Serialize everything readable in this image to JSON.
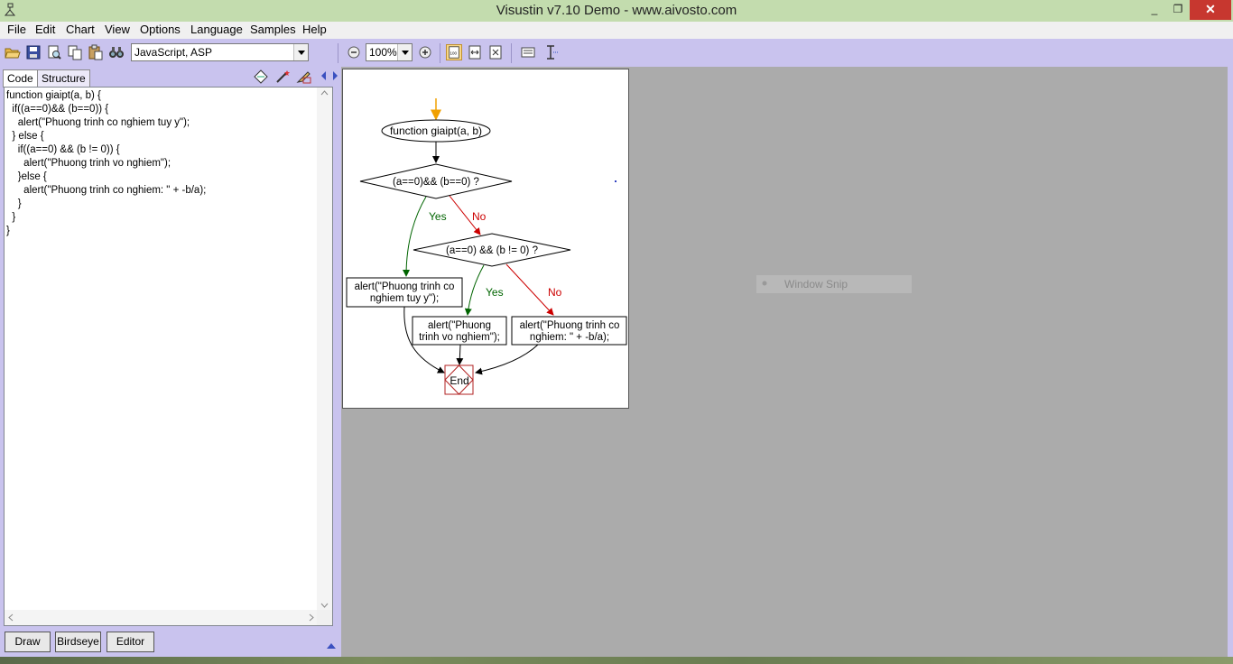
{
  "window": {
    "title": "Visustin v7.10 Demo - www.aivosto.com",
    "minimize": "_",
    "maximize": "❐",
    "close": "✕"
  },
  "menu": [
    "File",
    "Edit",
    "Chart",
    "View",
    "Options",
    "Language",
    "Samples",
    "Help"
  ],
  "toolbar": {
    "language": "JavaScript, ASP",
    "zoom": "100%",
    "icons": [
      "open-icon",
      "save-icon",
      "print-preview-icon",
      "copy-icon",
      "paste-icon",
      "find-icon",
      "zoom-out-icon",
      "zoom-in-icon",
      "actual-size-icon",
      "fit-width-icon",
      "fit-page-icon",
      "options-icon",
      "text-cursor-icon"
    ]
  },
  "tabs": {
    "code": "Code",
    "structure": "Structure"
  },
  "code": "function giaipt(a, b) {\n  if((a==0)&& (b==0)) {\n    alert(\"Phuong trinh co nghiem tuy y\");\n  } else {\n    if((a==0) && (b != 0)) {\n      alert(\"Phuong trinh vo nghiem\");\n    }else {\n      alert(\"Phuong trinh co nghiem: \" + -b/a);\n    }\n  }\n}",
  "buttons": {
    "draw": "Draw",
    "birdseye": "Birdseye",
    "editor": "Editor"
  },
  "flowchart": {
    "start": "function giaipt(a, b)",
    "cond1": "(a==0)&& (b==0) ?",
    "cond2": "(a==0) && (b != 0) ?",
    "yes": "Yes",
    "no": "No",
    "action1_line1": "alert(\"Phuong trinh co",
    "action1_line2": "nghiem tuy y\");",
    "action2_line1": "alert(\"Phuong",
    "action2_line2": "trinh vo nghiem\");",
    "action3_line1": "alert(\"Phuong trinh co",
    "action3_line2": "nghiem: \" + -b/a);",
    "end": "End"
  },
  "overlay": {
    "snip": "Window Snip"
  },
  "colors": {
    "yes": "#006400",
    "no": "#cc0000",
    "entry": "#f0a000",
    "end_border": "#b22222"
  }
}
